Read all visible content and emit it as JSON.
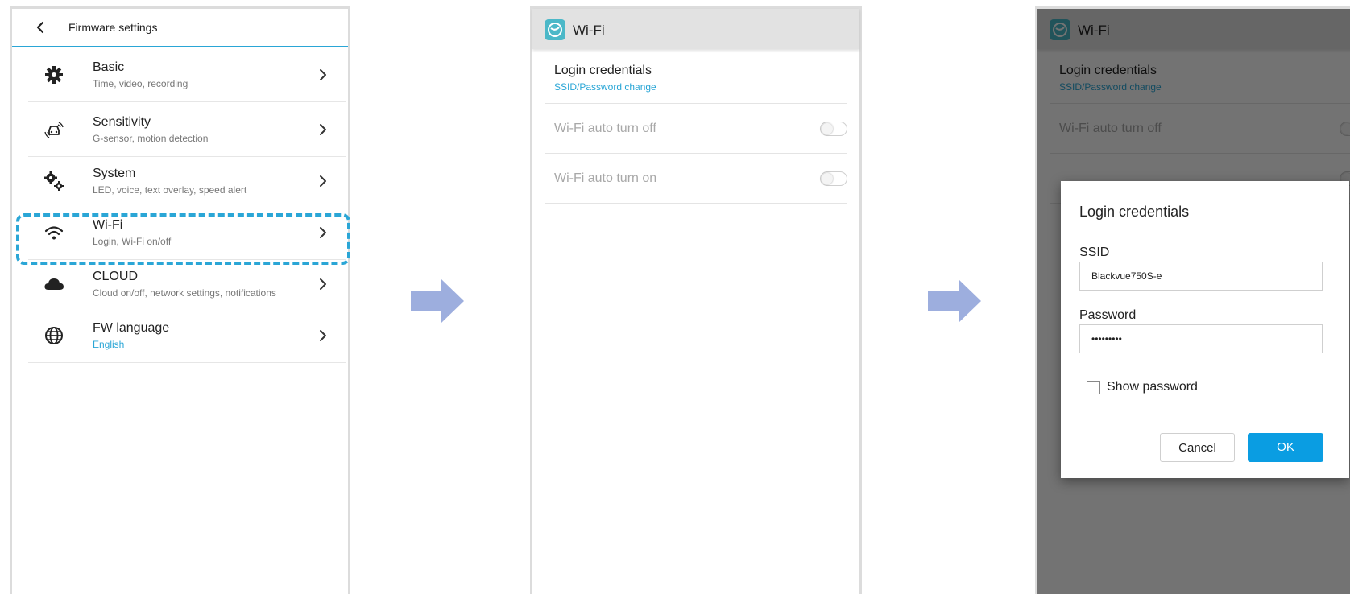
{
  "firmware_screen": {
    "header_title": "Firmware settings",
    "items": [
      {
        "icon": "gear-icon",
        "title": "Basic",
        "subtitle": "Time, video, recording"
      },
      {
        "icon": "car-sensor-icon",
        "title": "Sensitivity",
        "subtitle": "G-sensor, motion detection"
      },
      {
        "icon": "system-gears-icon",
        "title": "System",
        "subtitle": "LED, voice, text overlay, speed alert"
      },
      {
        "icon": "wifi-icon",
        "title": "Wi-Fi",
        "subtitle": "Login, Wi-Fi on/off"
      },
      {
        "icon": "cloud-icon",
        "title": "CLOUD",
        "subtitle": "Cloud on/off, network settings, notifications"
      },
      {
        "icon": "globe-icon",
        "title": "FW language",
        "subtitle": "English"
      }
    ],
    "highlighted_item": "Wi-Fi"
  },
  "wifi_screen": {
    "title": "Wi-Fi",
    "login_title": "Login credentials",
    "login_subtitle": "SSID/Password change",
    "auto_off_label": "Wi-Fi auto turn off",
    "auto_off_state": "off",
    "auto_on_label": "Wi-Fi auto turn on",
    "auto_on_state": "off"
  },
  "login_dialog": {
    "title": "Login credentials",
    "ssid_label": "SSID",
    "ssid_value": "Blackvue750S-e",
    "password_label": "Password",
    "password_value": "•••••••••",
    "show_password_label": "Show password",
    "show_password_checked": false,
    "cancel_label": "Cancel",
    "ok_label": "OK"
  },
  "colors": {
    "accent_blue": "#2aa6d6",
    "arrow_color": "#9daede",
    "ok_button": "#0a9de2"
  }
}
